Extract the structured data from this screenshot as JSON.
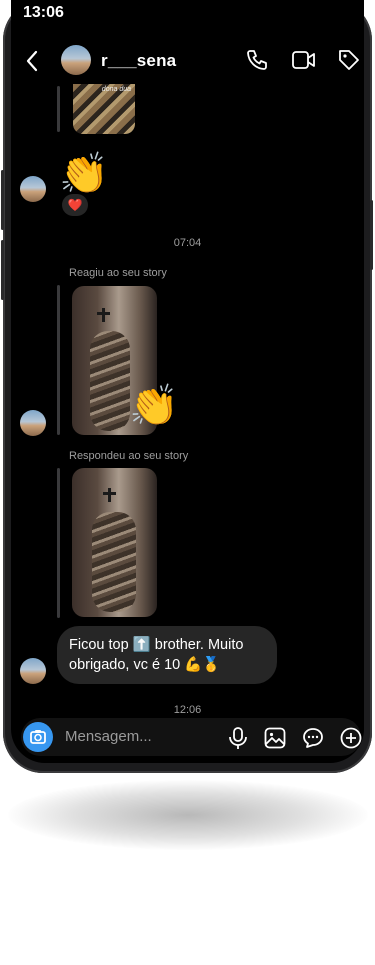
{
  "status": {
    "time": "13:06"
  },
  "header": {
    "username": "r___sena"
  },
  "messages": {
    "top_image_caption": "dona dua",
    "reaction_heart": "❤️",
    "time1": "07:04",
    "reacted_label": "Reagiu ao seu story",
    "clap": "👏",
    "replied_label": "Respondeu ao seu story",
    "text_line1": "Ficou top ⬆️ brother. Muito",
    "text_line2": "obrigado, vc é 10 💪🥇",
    "time2": "12:06"
  },
  "composer": {
    "placeholder": "Mensagem..."
  },
  "icons": {
    "back": "chevron-left-icon",
    "call": "phone-icon",
    "video": "video-camera-icon",
    "tag": "tag-icon",
    "camera": "camera-icon",
    "mic": "microphone-icon",
    "gallery": "image-icon",
    "sticker": "chat-bubble-icon",
    "add": "plus-circle-icon"
  },
  "colors": {
    "accent": "#3797f0",
    "bubble": "#262626",
    "background": "#000000"
  }
}
